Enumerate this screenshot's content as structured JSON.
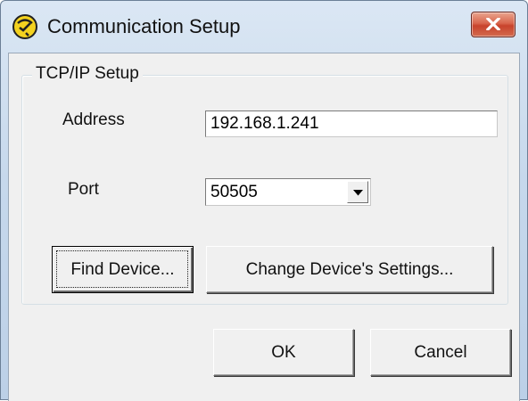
{
  "window": {
    "title": "Communication Setup",
    "icon": "communication-setup-icon",
    "close_icon": "close-icon"
  },
  "tcpip_group": {
    "legend": "TCP/IP Setup",
    "address_label": "Address",
    "address_value": "192.168.1.241",
    "port_label": "Port",
    "port_value": "50505",
    "find_device_label": "Find Device...",
    "change_settings_label": "Change Device's Settings..."
  },
  "footer": {
    "ok_label": "OK",
    "cancel_label": "Cancel"
  },
  "colors": {
    "title_bar": "#c6d8ec",
    "close_button": "#c8432c",
    "dialog_face": "#f0f0f0"
  }
}
